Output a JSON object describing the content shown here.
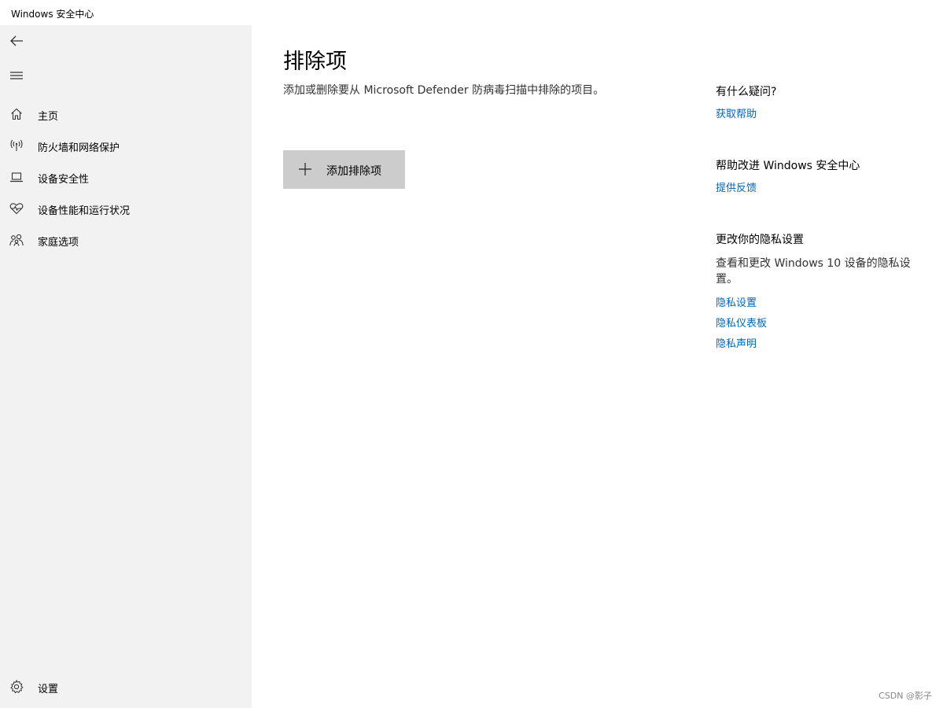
{
  "window": {
    "title": "Windows 安全中心"
  },
  "sidebar": {
    "back_icon": "back-arrow-icon",
    "menu_icon": "hamburger-menu-icon",
    "items": [
      {
        "label": "主页",
        "icon": "home-icon"
      },
      {
        "label": "防火墙和网络保护",
        "icon": "wireless-signal-icon"
      },
      {
        "label": "设备安全性",
        "icon": "laptop-icon"
      },
      {
        "label": "设备性能和运行状况",
        "icon": "heart-pulse-icon"
      },
      {
        "label": "家庭选项",
        "icon": "family-icon"
      }
    ],
    "settings": {
      "label": "设置",
      "icon": "gear-icon"
    }
  },
  "main": {
    "title": "排除项",
    "description": "添加或删除要从 Microsoft Defender 防病毒扫描中排除的项目。",
    "add_button": {
      "label": "添加排除项",
      "icon": "plus-icon"
    }
  },
  "side_panel": {
    "question": {
      "heading": "有什么疑问?",
      "link": "获取帮助"
    },
    "improve": {
      "heading": "帮助改进 Windows 安全中心",
      "link": "提供反馈"
    },
    "privacy": {
      "heading": "更改你的隐私设置",
      "text": "查看和更改 Windows 10 设备的隐私设置。",
      "links": [
        "隐私设置",
        "隐私仪表板",
        "隐私声明"
      ]
    }
  },
  "watermark": "CSDN @影子",
  "colors": {
    "sidebar_bg": "#f2f2f2",
    "link": "#0067b8",
    "button_bg": "#cccccc"
  }
}
